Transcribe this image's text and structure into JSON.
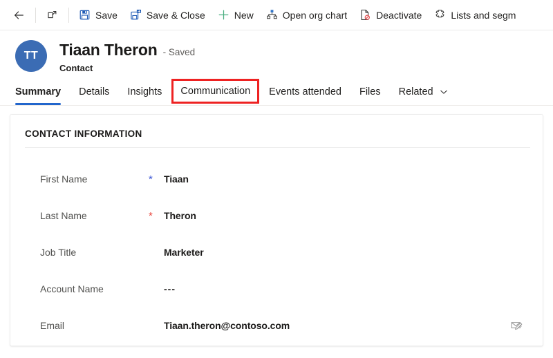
{
  "command_bar": {
    "back_label": "Back",
    "popout_label": "Open in new window",
    "buttons": [
      {
        "id": "save",
        "label": "Save",
        "icon": "save-icon"
      },
      {
        "id": "save-close",
        "label": "Save & Close",
        "icon": "save-and-close-icon"
      },
      {
        "id": "new",
        "label": "New",
        "icon": "plus-icon"
      },
      {
        "id": "org-chart",
        "label": "Open org chart",
        "icon": "org-chart-icon"
      },
      {
        "id": "deactivate",
        "label": "Deactivate",
        "icon": "deactivate-icon"
      },
      {
        "id": "lists-segments",
        "label": "Lists and segm",
        "icon": "lists-and-segments-icon"
      }
    ]
  },
  "record": {
    "avatar_initials": "TT",
    "name": "Tiaan Theron",
    "state": "- Saved",
    "entity": "Contact",
    "avatar_color": "#3b6cb4"
  },
  "tabs": [
    {
      "label": "Summary",
      "active": true,
      "highlighted": false,
      "chevron": false
    },
    {
      "label": "Details",
      "active": false,
      "highlighted": false,
      "chevron": false
    },
    {
      "label": "Insights",
      "active": false,
      "highlighted": false,
      "chevron": false
    },
    {
      "label": "Communication",
      "active": false,
      "highlighted": true,
      "chevron": false
    },
    {
      "label": "Events attended",
      "active": false,
      "highlighted": false,
      "chevron": false
    },
    {
      "label": "Files",
      "active": false,
      "highlighted": false,
      "chevron": false
    },
    {
      "label": "Related",
      "active": false,
      "highlighted": false,
      "chevron": true
    }
  ],
  "section": {
    "title": "CONTACT INFORMATION",
    "fields": [
      {
        "label": "First Name",
        "value": "Tiaan",
        "required": "recommended",
        "action_icon": null
      },
      {
        "label": "Last Name",
        "value": "Theron",
        "required": "required",
        "action_icon": null
      },
      {
        "label": "Job Title",
        "value": "Marketer",
        "required": "none",
        "action_icon": null
      },
      {
        "label": "Account Name",
        "value": "---",
        "required": "none",
        "action_icon": null
      },
      {
        "label": "Email",
        "value": "Tiaan.theron@contoso.com",
        "required": "none",
        "action_icon": "compose-email-icon"
      }
    ]
  },
  "colors": {
    "accent": "#2266cc",
    "highlight_box": "#ee2222",
    "required_red": "#e8453c",
    "recommended_blue": "#3b55d4"
  }
}
